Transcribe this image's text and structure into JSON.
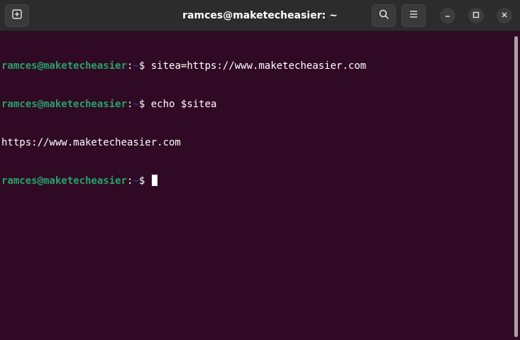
{
  "window": {
    "title": "ramces@maketecheasier: ~"
  },
  "icons": {
    "new_tab": "new-tab-icon",
    "search": "search-icon",
    "menu": "hamburger-menu-icon",
    "minimize": "minimize-icon",
    "maximize": "maximize-icon",
    "close": "close-icon"
  },
  "colors": {
    "background": "#300a24",
    "titlebar": "#2c2c2c",
    "prompt_user": "#26a269",
    "prompt_path": "#12488b",
    "text": "#ffffff"
  },
  "terminal": {
    "lines": [
      {
        "user": "ramces@maketecheasier",
        "sep": ":",
        "path": "~",
        "symbol": "$ ",
        "command": "sitea=https://www.maketecheasier.com"
      },
      {
        "user": "ramces@maketecheasier",
        "sep": ":",
        "path": "~",
        "symbol": "$ ",
        "command": "echo $sitea"
      },
      {
        "output": "https://www.maketecheasier.com"
      },
      {
        "user": "ramces@maketecheasier",
        "sep": ":",
        "path": "~",
        "symbol": "$ ",
        "command": ""
      }
    ]
  }
}
